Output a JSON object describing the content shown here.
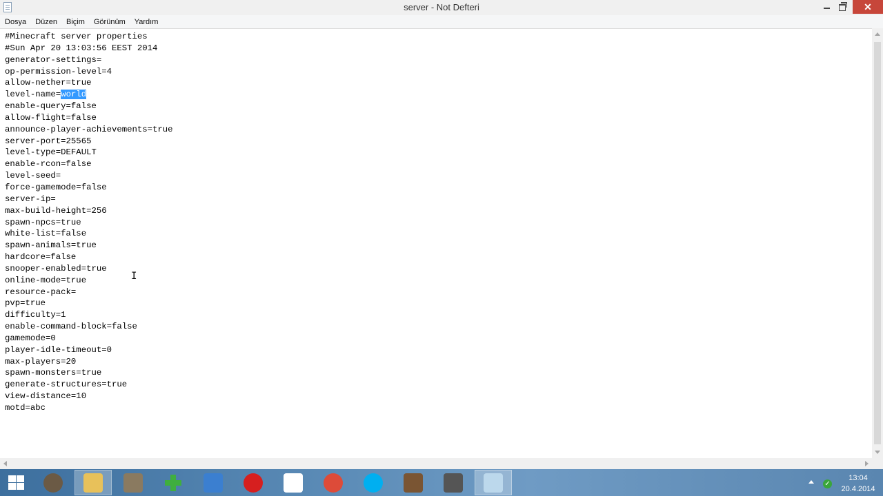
{
  "window": {
    "title": "server - Not Defteri"
  },
  "menu": [
    "Dosya",
    "Düzen",
    "Biçim",
    "Görünüm",
    "Yardım"
  ],
  "editor": {
    "lines": [
      "#Minecraft server properties",
      "#Sun Apr 20 13:03:56 EEST 2014",
      "generator-settings=",
      "op-permission-level=4",
      "allow-nether=true",
      "level-name=",
      "enable-query=false",
      "allow-flight=false",
      "announce-player-achievements=true",
      "server-port=25565",
      "level-type=DEFAULT",
      "enable-rcon=false",
      "level-seed=",
      "force-gamemode=false",
      "server-ip=",
      "max-build-height=256",
      "spawn-npcs=true",
      "white-list=false",
      "spawn-animals=true",
      "hardcore=false",
      "snooper-enabled=true",
      "online-mode=true",
      "resource-pack=",
      "pvp=true",
      "difficulty=1",
      "enable-command-block=false",
      "gamemode=0",
      "player-idle-timeout=0",
      "max-players=20",
      "spawn-monsters=true",
      "generate-structures=true",
      "view-distance=10",
      "motd=abc"
    ],
    "selected_text": "world",
    "selected_line_index": 5
  },
  "taskbar": {
    "items": [
      {
        "name": "start-button",
        "icon": "windows-logo-icon",
        "color": "#ffffff"
      },
      {
        "name": "speaker-app",
        "icon": "speaker-icon",
        "color": "#6b5a45"
      },
      {
        "name": "file-explorer",
        "icon": "folder-icon",
        "color": "#e8c15a",
        "active": true
      },
      {
        "name": "media-app",
        "icon": "media-icon",
        "color": "#8a7a60"
      },
      {
        "name": "green-plus-app",
        "icon": "green-plus-icon",
        "color": "#3fae3f"
      },
      {
        "name": "control-app",
        "icon": "control-panel-icon",
        "color": "#3b7fd0"
      },
      {
        "name": "record-app",
        "icon": "record-icon",
        "color": "#d61f1f"
      },
      {
        "name": "yandex-browser",
        "icon": "yandex-icon",
        "color": "#e43b2c"
      },
      {
        "name": "chrome-browser",
        "icon": "chrome-icon",
        "color": "#dd4b39"
      },
      {
        "name": "skype",
        "icon": "skype-icon",
        "color": "#00aff0"
      },
      {
        "name": "minecraft",
        "icon": "crafting-table-icon",
        "color": "#7a5533"
      },
      {
        "name": "minecraft-server",
        "icon": "server-tool-icon",
        "color": "#555555"
      },
      {
        "name": "notepad",
        "icon": "notepad-icon",
        "color": "#bcd8ec",
        "active": true
      }
    ]
  },
  "tray": {
    "time": "13:04",
    "date": "20.4.2014"
  }
}
